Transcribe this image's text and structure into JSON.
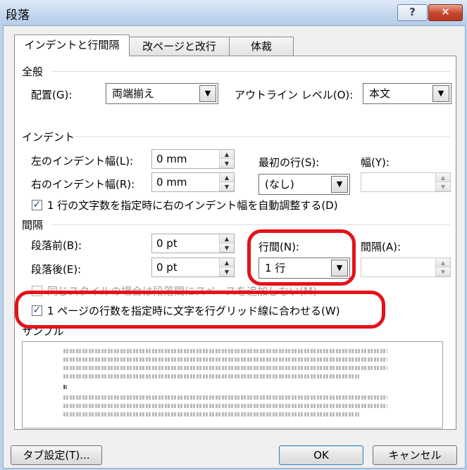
{
  "window": {
    "title": "段落",
    "help_label": "?",
    "close_label": "✕"
  },
  "tabs": [
    {
      "label": "インデントと行間隔"
    },
    {
      "label": "改ページと改行"
    },
    {
      "label": "体裁"
    }
  ],
  "general": {
    "heading": "全般",
    "alignment_label": "配置(G):",
    "alignment_value": "両端揃え",
    "outline_label": "アウトライン レベル(O):",
    "outline_value": "本文"
  },
  "indent": {
    "heading": "インデント",
    "left_label": "左のインデント幅(L):",
    "left_value": "0 mm",
    "right_label": "右のインデント幅(R):",
    "right_value": "0 mm",
    "first_line_label": "最初の行(S):",
    "first_line_value": "(なし)",
    "width_label": "幅(Y):",
    "auto_adjust_label": "1 行の文字数を指定時に右のインデント幅を自動調整する(D)",
    "auto_adjust_checked": true
  },
  "spacing": {
    "heading": "間隔",
    "before_label": "段落前(B):",
    "before_value": "0 pt",
    "after_label": "段落後(E):",
    "after_value": "0 pt",
    "line_spacing_label": "行間(N):",
    "line_spacing_value": "1 行",
    "at_label": "間隔(A):",
    "no_space_label": "同じスタイルの場合は段落間にスペースを追加しない(M)",
    "snap_grid_label": "1 ページの行数を指定時に文字を行グリッド線に合わせる(W)",
    "snap_grid_checked": true
  },
  "preview": {
    "heading": "サンプル"
  },
  "buttons": {
    "tabs": "タブ設定(T)...",
    "ok": "OK",
    "cancel": "キャンセル"
  },
  "icons": {
    "check": "✓",
    "arrow_down": "▼",
    "spin_up": "▲",
    "spin_down": "▼"
  },
  "colors": {
    "highlight": "#e4121a",
    "check": "#1c3f94"
  }
}
